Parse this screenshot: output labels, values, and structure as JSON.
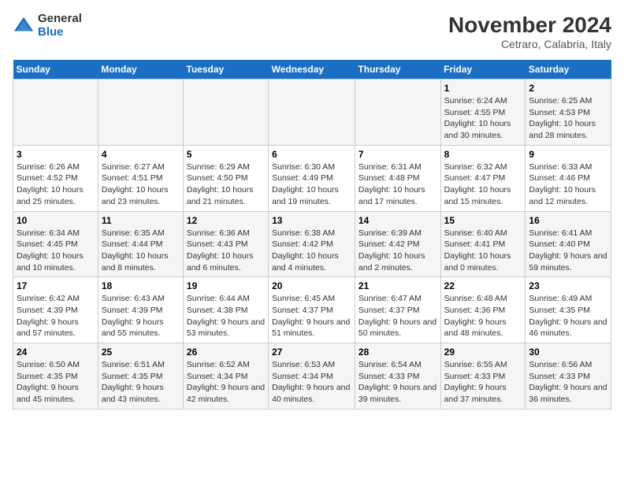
{
  "logo": {
    "general": "General",
    "blue": "Blue"
  },
  "title": "November 2024",
  "subtitle": "Cetraro, Calabria, Italy",
  "weekdays": [
    "Sunday",
    "Monday",
    "Tuesday",
    "Wednesday",
    "Thursday",
    "Friday",
    "Saturday"
  ],
  "weeks": [
    [
      {
        "day": "",
        "info": ""
      },
      {
        "day": "",
        "info": ""
      },
      {
        "day": "",
        "info": ""
      },
      {
        "day": "",
        "info": ""
      },
      {
        "day": "",
        "info": ""
      },
      {
        "day": "1",
        "info": "Sunrise: 6:24 AM\nSunset: 4:55 PM\nDaylight: 10 hours and 30 minutes."
      },
      {
        "day": "2",
        "info": "Sunrise: 6:25 AM\nSunset: 4:53 PM\nDaylight: 10 hours and 28 minutes."
      }
    ],
    [
      {
        "day": "3",
        "info": "Sunrise: 6:26 AM\nSunset: 4:52 PM\nDaylight: 10 hours and 25 minutes."
      },
      {
        "day": "4",
        "info": "Sunrise: 6:27 AM\nSunset: 4:51 PM\nDaylight: 10 hours and 23 minutes."
      },
      {
        "day": "5",
        "info": "Sunrise: 6:29 AM\nSunset: 4:50 PM\nDaylight: 10 hours and 21 minutes."
      },
      {
        "day": "6",
        "info": "Sunrise: 6:30 AM\nSunset: 4:49 PM\nDaylight: 10 hours and 19 minutes."
      },
      {
        "day": "7",
        "info": "Sunrise: 6:31 AM\nSunset: 4:48 PM\nDaylight: 10 hours and 17 minutes."
      },
      {
        "day": "8",
        "info": "Sunrise: 6:32 AM\nSunset: 4:47 PM\nDaylight: 10 hours and 15 minutes."
      },
      {
        "day": "9",
        "info": "Sunrise: 6:33 AM\nSunset: 4:46 PM\nDaylight: 10 hours and 12 minutes."
      }
    ],
    [
      {
        "day": "10",
        "info": "Sunrise: 6:34 AM\nSunset: 4:45 PM\nDaylight: 10 hours and 10 minutes."
      },
      {
        "day": "11",
        "info": "Sunrise: 6:35 AM\nSunset: 4:44 PM\nDaylight: 10 hours and 8 minutes."
      },
      {
        "day": "12",
        "info": "Sunrise: 6:36 AM\nSunset: 4:43 PM\nDaylight: 10 hours and 6 minutes."
      },
      {
        "day": "13",
        "info": "Sunrise: 6:38 AM\nSunset: 4:42 PM\nDaylight: 10 hours and 4 minutes."
      },
      {
        "day": "14",
        "info": "Sunrise: 6:39 AM\nSunset: 4:42 PM\nDaylight: 10 hours and 2 minutes."
      },
      {
        "day": "15",
        "info": "Sunrise: 6:40 AM\nSunset: 4:41 PM\nDaylight: 10 hours and 0 minutes."
      },
      {
        "day": "16",
        "info": "Sunrise: 6:41 AM\nSunset: 4:40 PM\nDaylight: 9 hours and 59 minutes."
      }
    ],
    [
      {
        "day": "17",
        "info": "Sunrise: 6:42 AM\nSunset: 4:39 PM\nDaylight: 9 hours and 57 minutes."
      },
      {
        "day": "18",
        "info": "Sunrise: 6:43 AM\nSunset: 4:39 PM\nDaylight: 9 hours and 55 minutes."
      },
      {
        "day": "19",
        "info": "Sunrise: 6:44 AM\nSunset: 4:38 PM\nDaylight: 9 hours and 53 minutes."
      },
      {
        "day": "20",
        "info": "Sunrise: 6:45 AM\nSunset: 4:37 PM\nDaylight: 9 hours and 51 minutes."
      },
      {
        "day": "21",
        "info": "Sunrise: 6:47 AM\nSunset: 4:37 PM\nDaylight: 9 hours and 50 minutes."
      },
      {
        "day": "22",
        "info": "Sunrise: 6:48 AM\nSunset: 4:36 PM\nDaylight: 9 hours and 48 minutes."
      },
      {
        "day": "23",
        "info": "Sunrise: 6:49 AM\nSunset: 4:35 PM\nDaylight: 9 hours and 46 minutes."
      }
    ],
    [
      {
        "day": "24",
        "info": "Sunrise: 6:50 AM\nSunset: 4:35 PM\nDaylight: 9 hours and 45 minutes."
      },
      {
        "day": "25",
        "info": "Sunrise: 6:51 AM\nSunset: 4:35 PM\nDaylight: 9 hours and 43 minutes."
      },
      {
        "day": "26",
        "info": "Sunrise: 6:52 AM\nSunset: 4:34 PM\nDaylight: 9 hours and 42 minutes."
      },
      {
        "day": "27",
        "info": "Sunrise: 6:53 AM\nSunset: 4:34 PM\nDaylight: 9 hours and 40 minutes."
      },
      {
        "day": "28",
        "info": "Sunrise: 6:54 AM\nSunset: 4:33 PM\nDaylight: 9 hours and 39 minutes."
      },
      {
        "day": "29",
        "info": "Sunrise: 6:55 AM\nSunset: 4:33 PM\nDaylight: 9 hours and 37 minutes."
      },
      {
        "day": "30",
        "info": "Sunrise: 6:56 AM\nSunset: 4:33 PM\nDaylight: 9 hours and 36 minutes."
      }
    ]
  ]
}
